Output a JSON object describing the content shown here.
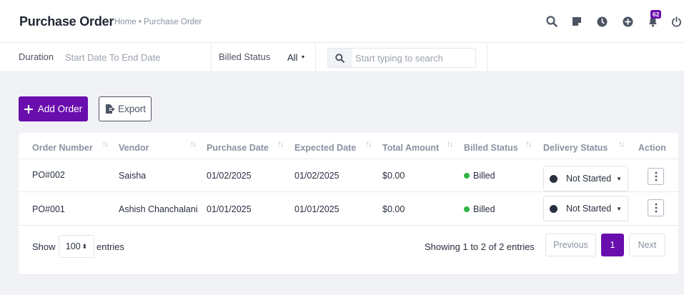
{
  "header": {
    "title": "Purchase Order",
    "breadcrumb": "Home • Purchase Order",
    "notification_count": "62"
  },
  "filters": {
    "duration_label": "Duration",
    "duration_placeholder": "Start Date To End Date",
    "billed_status_label": "Billed Status",
    "billed_status_value": "All",
    "search_placeholder": "Start typing to search"
  },
  "actions": {
    "add_order": "Add Order",
    "export": "Export"
  },
  "table": {
    "columns": [
      "Order Number",
      "Vendor",
      "Purchase Date",
      "Expected Date",
      "Total Amount",
      "Billed Status",
      "Delivery Status",
      "Action"
    ],
    "rows": [
      {
        "order_number": "PO#002",
        "vendor": "Saisha",
        "purchase_date": "01/02/2025",
        "expected_date": "01/02/2025",
        "total_amount": "$0.00",
        "billed_status": "Billed",
        "delivery_status": "Not Started"
      },
      {
        "order_number": "PO#001",
        "vendor": "Ashish Chanchalani",
        "purchase_date": "01/01/2025",
        "expected_date": "01/01/2025",
        "total_amount": "$0.00",
        "billed_status": "Billed",
        "delivery_status": "Not Started"
      }
    ]
  },
  "footer": {
    "show_label": "Show",
    "page_size": "100",
    "entries_label": "entries",
    "showing_text": "Showing 1 to 2 of 2 entries",
    "previous": "Previous",
    "current_page": "1",
    "next": "Next"
  },
  "colors": {
    "brand": "#6a0dad",
    "billed": "#2fb344"
  }
}
